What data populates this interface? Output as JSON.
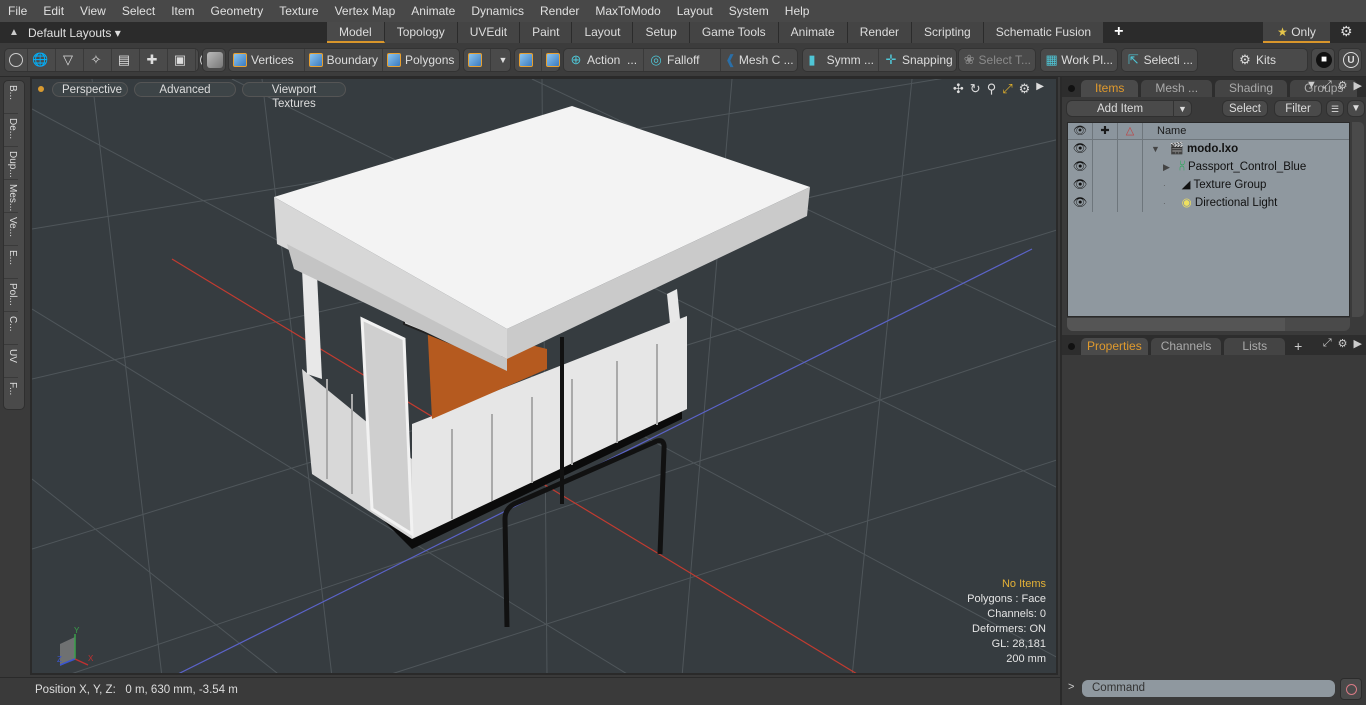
{
  "menubar": [
    "File",
    "Edit",
    "View",
    "Select",
    "Item",
    "Geometry",
    "Texture",
    "Vertex Map",
    "Animate",
    "Dynamics",
    "Render",
    "MaxToModo",
    "Layout",
    "System",
    "Help"
  ],
  "layout_selector": "Default Layouts ▾",
  "tabs": [
    {
      "label": "Model",
      "active": true
    },
    {
      "label": "Topology"
    },
    {
      "label": "UVEdit"
    },
    {
      "label": "Paint"
    },
    {
      "label": "Layout"
    },
    {
      "label": "Setup"
    },
    {
      "label": "Game Tools"
    },
    {
      "label": "Animate"
    },
    {
      "label": "Render"
    },
    {
      "label": "Scripting"
    },
    {
      "label": "Schematic Fusion"
    }
  ],
  "tab_add": "+",
  "only_label": "Only",
  "toolbar": {
    "vertices": "Vertices",
    "boundary": "Boundary",
    "polygons": "Polygons",
    "action": "Action",
    "action_more": "...",
    "falloff": "Falloff",
    "mesh_c": "Mesh C ...",
    "symm": "Symm ...",
    "snapping": "Snapping",
    "select_t": "Select T...",
    "work_pl": "Work Pl...",
    "selecti": "Selecti ...",
    "kits": "Kits"
  },
  "left_tools": [
    "B...",
    "De...",
    "Dup...",
    "Mes...",
    "Ve...",
    "E...",
    "Pol...",
    "C...",
    "UV",
    "F..."
  ],
  "viewport": {
    "view_mode": "Perspective",
    "shading": "Advanced",
    "textures": "Viewport Textures",
    "info": {
      "selection": "No Items",
      "polygons": "Polygons : Face",
      "channels": "Channels: 0",
      "deformers": "Deformers: ON",
      "gl": "GL: 28,181",
      "grid": "200 mm"
    },
    "axes": {
      "x": "X",
      "y": "Y",
      "z": "Z"
    }
  },
  "status": {
    "position_label": "Position X, Y, Z:",
    "position_value": "0 m, 630 mm, -3.54 m"
  },
  "right_panel": {
    "tabs": [
      {
        "label": "Items",
        "active": true
      },
      {
        "label": "Mesh ..."
      },
      {
        "label": "Shading"
      },
      {
        "label": "Groups"
      }
    ],
    "add_item": "Add Item",
    "select": "Select",
    "filter": "Filter",
    "column_name": "Name",
    "items": [
      {
        "name": "modo.lxo",
        "level": 0,
        "bold": true,
        "icon": "scene-icon"
      },
      {
        "name": "Passport_Control_Blue",
        "level": 1,
        "icon": "mesh-locator-icon"
      },
      {
        "name": "Texture Group",
        "level": 1,
        "icon": "texture-group-icon"
      },
      {
        "name": "Directional Light",
        "level": 1,
        "icon": "light-icon"
      }
    ],
    "prop_tabs": [
      {
        "label": "Properties",
        "active": true
      },
      {
        "label": "Channels"
      },
      {
        "label": "Lists"
      }
    ],
    "prop_add": "+",
    "command_placeholder": "Command",
    "command_prompt": ">"
  }
}
